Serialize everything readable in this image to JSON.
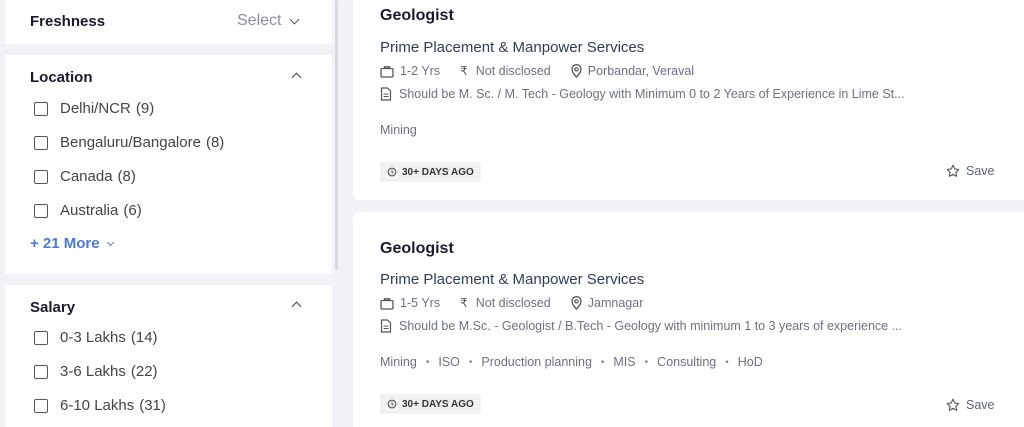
{
  "filters": {
    "freshness": {
      "title": "Freshness",
      "select_label": "Select"
    },
    "location": {
      "title": "Location",
      "options": [
        {
          "label": "Delhi/NCR",
          "count": "(9)"
        },
        {
          "label": "Bengaluru/Bangalore",
          "count": "(8)"
        },
        {
          "label": "Canada",
          "count": "(8)"
        },
        {
          "label": "Australia",
          "count": "(6)"
        }
      ],
      "more_label": "+ 21 More"
    },
    "salary": {
      "title": "Salary",
      "options": [
        {
          "label": "0-3 Lakhs",
          "count": "(14)"
        },
        {
          "label": "3-6 Lakhs",
          "count": "(22)"
        },
        {
          "label": "6-10 Lakhs",
          "count": "(31)"
        }
      ]
    }
  },
  "jobs": [
    {
      "title": "Geologist",
      "company": "Prime Placement & Manpower Services",
      "experience": "1-2 Yrs",
      "salary": "Not disclosed",
      "location": "Porbandar, Veraval",
      "description": "Should be M. Sc. / M. Tech - Geology with Minimum 0 to 2 Years of Experience in Lime St...",
      "tags": [
        "Mining"
      ],
      "posted": "30+ DAYS AGO",
      "save_label": "Save"
    },
    {
      "title": "Geologist",
      "company": "Prime Placement & Manpower Services",
      "experience": "1-5 Yrs",
      "salary": "Not disclosed",
      "location": "Jamnagar",
      "description": "Should be M.Sc. - Geologist / B.Tech - Geology with minimum 1 to 3 years of experience ...",
      "tags": [
        "Mining",
        "ISO",
        "Production planning",
        "MIS",
        "Consulting",
        "HoD"
      ],
      "posted": "30+ DAYS AGO",
      "save_label": "Save"
    }
  ],
  "colors": {
    "highlight": "#f6f300",
    "link": "#4a79d6",
    "title": "#1a1a2e"
  }
}
